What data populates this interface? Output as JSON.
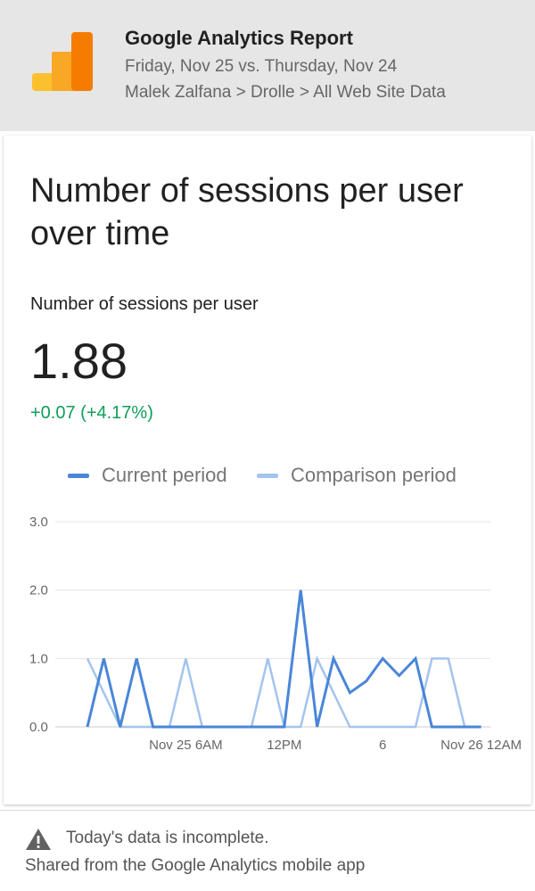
{
  "header": {
    "title": "Google Analytics Report",
    "date_range": "Friday, Nov 25 vs. Thursday, Nov 24",
    "breadcrumb": "Malek Zalfana > Drolle > All Web Site Data",
    "logo_icon": "google-analytics-logo-icon",
    "colors": {
      "background": "#e6e6e6",
      "logo_dark": "#f57c00",
      "logo_light": "#fbc02d"
    }
  },
  "card": {
    "title": "Number of sessions per user over time",
    "metric_label": "Number of sessions per user",
    "metric_value": "1.88",
    "metric_delta": "+0.07 (+4.17%)",
    "delta_color": "#0f9d58"
  },
  "chart_data": {
    "type": "line",
    "legend_placement": "top",
    "grid": true,
    "ylim": [
      0,
      3
    ],
    "y_ticks": [
      "0.0",
      "1.0",
      "2.0",
      "3.0"
    ],
    "x_tick_labels": [
      {
        "label": "Nov 25 6AM",
        "hour": 6
      },
      {
        "label": "12PM",
        "hour": 12
      },
      {
        "label": "6",
        "hour": 18
      },
      {
        "label": "Nov 26 12AM",
        "hour": 24
      }
    ],
    "series": [
      {
        "name": "Current period",
        "color": "#4a86d8",
        "hours": [
          0,
          1,
          2,
          3,
          4,
          5,
          6,
          7,
          8,
          9,
          10,
          11,
          12,
          13,
          14,
          15,
          16,
          17,
          18,
          19,
          20,
          21,
          22,
          23,
          24
        ],
        "values": [
          0,
          1,
          0,
          1,
          0,
          0,
          0,
          0,
          0,
          0,
          0,
          0,
          0,
          2,
          0,
          1,
          0.5,
          0.67,
          1,
          0.75,
          1,
          0,
          0,
          0,
          0
        ]
      },
      {
        "name": "Comparison period",
        "color": "#a4c4ee",
        "hours": [
          0,
          1,
          2,
          3,
          4,
          5,
          6,
          7,
          8,
          9,
          10,
          11,
          12,
          13,
          14,
          15,
          16,
          17,
          18,
          19,
          20,
          21,
          22,
          23,
          24
        ],
        "values": [
          1,
          0.5,
          0,
          0,
          0,
          0,
          1,
          0,
          0,
          0,
          0,
          1,
          0,
          0,
          1,
          0.5,
          0,
          0,
          0,
          0,
          0,
          1,
          1,
          0,
          0
        ]
      }
    ]
  },
  "footer": {
    "warning_icon": "warning-triangle-icon",
    "warning_text": "Today's data is incomplete.",
    "shared_text": "Shared from the Google Analytics mobile app"
  }
}
